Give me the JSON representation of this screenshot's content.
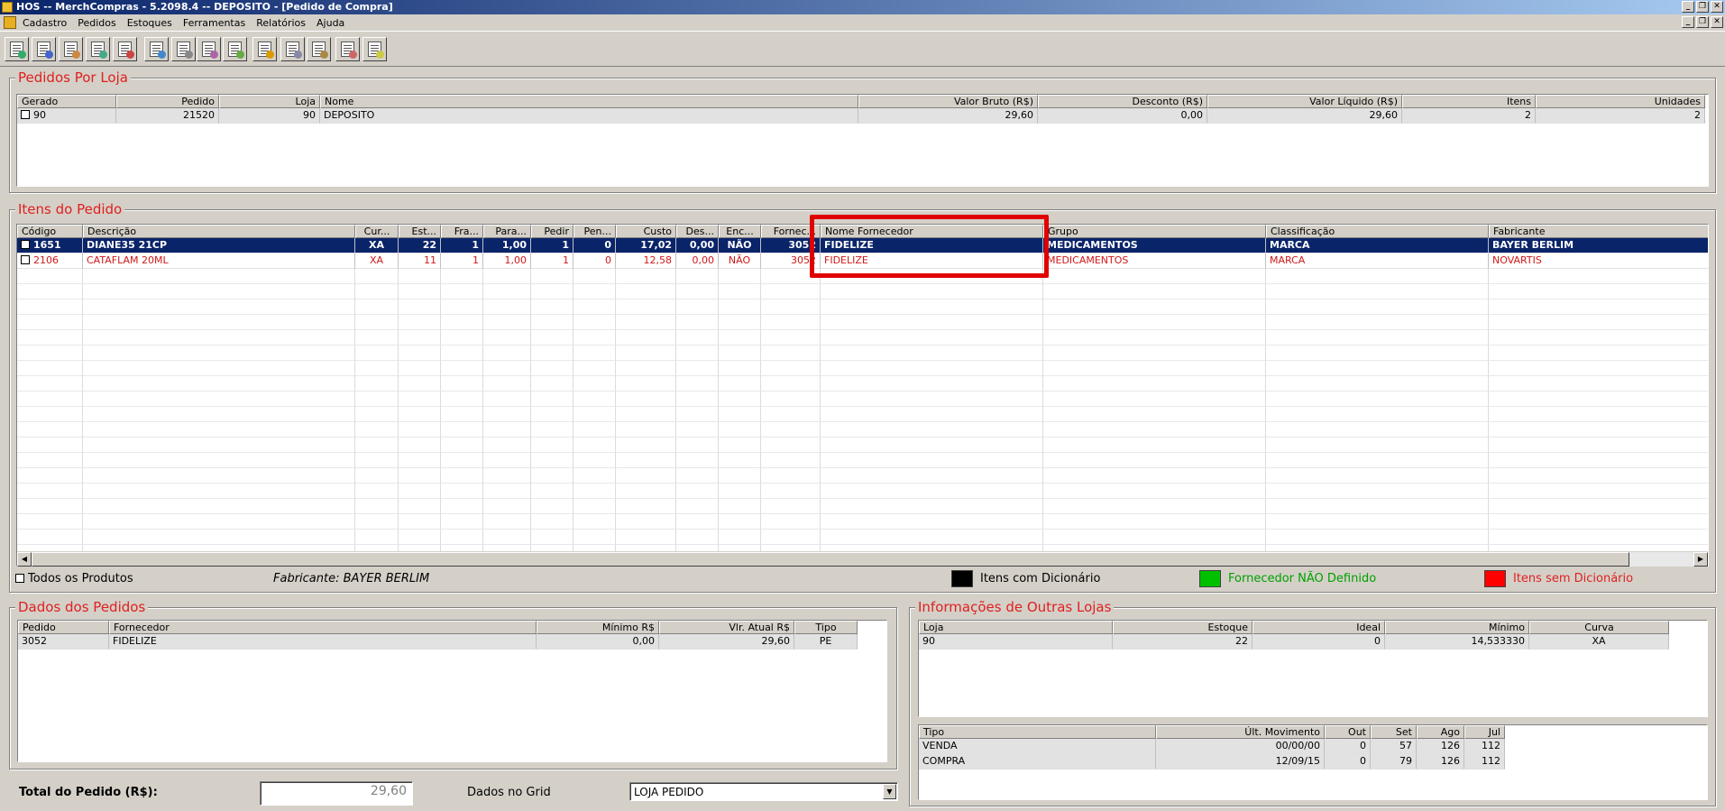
{
  "window": {
    "title": "HOS -- MerchCompras - 5.2098.4  --  DEPOSITO - [Pedido de Compra]"
  },
  "menu": [
    "Cadastro",
    "Pedidos",
    "Estoques",
    "Ferramentas",
    "Relatórios",
    "Ajuda"
  ],
  "window_buttons": [
    "_",
    "❐",
    "✕"
  ],
  "toolbar_icons": [
    "new-doc-icon",
    "list-icon",
    "save-icon",
    "search-doc-icon",
    "refresh-icon",
    "edit-icon",
    "print-icon",
    "tools-icon",
    "find-icon",
    "chart-icon",
    "report-icon",
    "battery-icon",
    "settings-icon",
    "disc-icon"
  ],
  "pedidos_loja": {
    "title": "Pedidos Por Loja",
    "headers": [
      "Gerado",
      "Pedido",
      "Loja",
      "Nome",
      "Valor Bruto (R$)",
      "Desconto (R$)",
      "Valor Líquido (R$)",
      "Itens",
      "Unidades"
    ],
    "rows": [
      [
        "90",
        "21520",
        "90",
        "DEPOSITO",
        "29,60",
        "0,00",
        "29,60",
        "2",
        "2"
      ]
    ]
  },
  "itens": {
    "title": "Itens do Pedido",
    "headers": [
      "Código",
      "Descrição",
      "Cur...",
      "Est...",
      "Fra...",
      "Para...",
      "Pedir",
      "Pen...",
      "Custo",
      "Des...",
      "Enc...",
      "Fornec...",
      "Nome Fornecedor",
      "Grupo",
      "Classificação",
      "Fabricante"
    ],
    "rows": [
      [
        "1651",
        "DIANE35 21CP",
        "XA",
        "22",
        "1",
        "1,00",
        "1",
        "0",
        "17,02",
        "0,00",
        "NÃO",
        "3052",
        "FIDELIZE",
        "MEDICAMENTOS",
        "MARCA",
        "BAYER BERLIM"
      ],
      [
        "2106",
        "CATAFLAM 20ML",
        "XA",
        "11",
        "1",
        "1,00",
        "1",
        "0",
        "12,58",
        "0,00",
        "NÃO",
        "3052",
        "FIDELIZE",
        "MEDICAMENTOS",
        "MARCA",
        "NOVARTIS"
      ]
    ]
  },
  "filters": {
    "todos_label": "Todos os Produtos",
    "fabricante_text": "Fabricante: BAYER BERLIM"
  },
  "legend": [
    {
      "label": "Itens com Dicionário",
      "color": "#000000",
      "text_color": "#000000"
    },
    {
      "label": "Fornecedor NÃO Definido",
      "color": "#00c000",
      "text_color": "#00a000"
    },
    {
      "label": "Itens sem Dicionário",
      "color": "#ff0000",
      "text_color": "#e02020"
    }
  ],
  "dados_pedidos": {
    "title": "Dados dos Pedidos",
    "headers": [
      "Pedido",
      "Fornecedor",
      "Mínimo R$",
      "Vlr. Atual R$",
      "Tipo"
    ],
    "rows": [
      [
        "3052",
        "FIDELIZE",
        "0,00",
        "29,60",
        "PE"
      ]
    ]
  },
  "outras_lojas": {
    "title": "Informações de Outras Lojas",
    "headers": [
      "Loja",
      "Estoque",
      "Ideal",
      "Mínimo",
      "Curva"
    ],
    "rows": [
      [
        "90",
        "22",
        "0",
        "14,533330",
        "XA"
      ]
    ]
  },
  "movimentos": {
    "headers": [
      "Tipo",
      "Últ. Movimento",
      "Out",
      "Set",
      "Ago",
      "Jul"
    ],
    "rows": [
      [
        "VENDA",
        "00/00/00",
        "0",
        "57",
        "126",
        "112"
      ],
      [
        "COMPRA",
        "12/09/15",
        "0",
        "79",
        "126",
        "112"
      ]
    ]
  },
  "footer": {
    "total_label": "Total do Pedido (R$):",
    "total_value": "29,60",
    "grid_label": "Dados no Grid",
    "grid_select": "LOJA PEDIDO"
  }
}
